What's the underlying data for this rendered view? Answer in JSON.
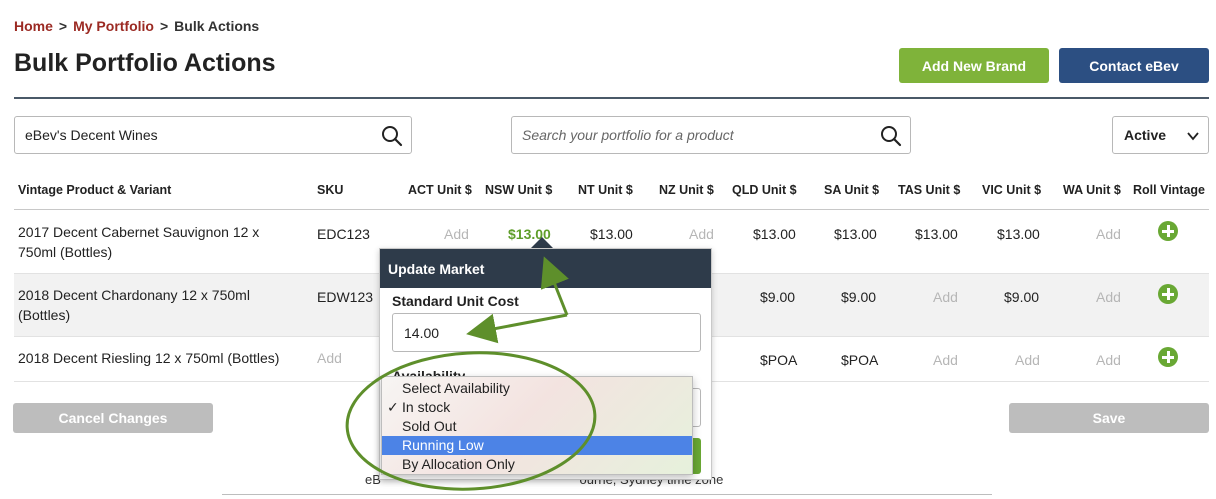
{
  "breadcrumb": {
    "home": "Home",
    "sep": ">",
    "portfolio": "My Portfolio",
    "current": "Bulk Actions"
  },
  "page_title": "Bulk Portfolio Actions",
  "actions": {
    "add_brand": "Add New Brand",
    "contact": "Contact eBev"
  },
  "filters": {
    "brand_value": "eBev's Decent Wines",
    "search_placeholder": "Search your portfolio for a product",
    "status_value": "Active"
  },
  "columns": [
    "Vintage Product & Variant",
    "SKU",
    "ACT Unit $",
    "NSW Unit $",
    "NT Unit $",
    "NZ Unit $",
    "QLD Unit $",
    "SA Unit $",
    "TAS Unit $",
    "VIC Unit $",
    "WA Unit $",
    "Roll Vintage"
  ],
  "rows": [
    {
      "product": "2017 Decent Cabernet Sauvignon 12 x 750ml (Bottles)",
      "sku": "EDC123",
      "act": "Add",
      "nsw": "$13.00",
      "nt": "$13.00",
      "nz": "Add",
      "qld": "$13.00",
      "sa": "$13.00",
      "tas": "$13.00",
      "vic": "$13.00",
      "wa": "Add"
    },
    {
      "product": "2018 Decent Chardonany 12 x 750ml (Bottles)",
      "sku": "EDW123",
      "qld": "$9.00",
      "sa": "$9.00",
      "tas": "Add",
      "vic": "$9.00",
      "wa": "Add"
    },
    {
      "product": "2018 Decent Riesling 12 x 750ml (Bottles)",
      "sku": "Add",
      "qld": "$POA",
      "sa": "$POA",
      "tas": "Add",
      "vic": "Add",
      "wa": "Add"
    }
  ],
  "buttons": {
    "cancel": "Cancel Changes",
    "save": "Save"
  },
  "footer": "eB                                                       ourne, Sydney time zone",
  "popover": {
    "title": "Update Market",
    "cost_label": "Standard Unit Cost",
    "cost_value": "14.00",
    "availability_label": "Availability"
  },
  "availability_options": [
    {
      "label": "Select Availability",
      "checked": false,
      "highlighted": false
    },
    {
      "label": "In stock",
      "checked": true,
      "highlighted": false
    },
    {
      "label": "Sold Out",
      "checked": false,
      "highlighted": false
    },
    {
      "label": "Running Low",
      "checked": false,
      "highlighted": true
    },
    {
      "label": "By Allocation Only",
      "checked": false,
      "highlighted": false
    }
  ],
  "check_mark": "✓",
  "colors": {
    "brand_red": "#9b2a23",
    "accent_green": "#7fb33a",
    "navy": "#2c4f82",
    "annotation_green": "#5e8f2b",
    "highlight_blue": "#4c83e6"
  }
}
